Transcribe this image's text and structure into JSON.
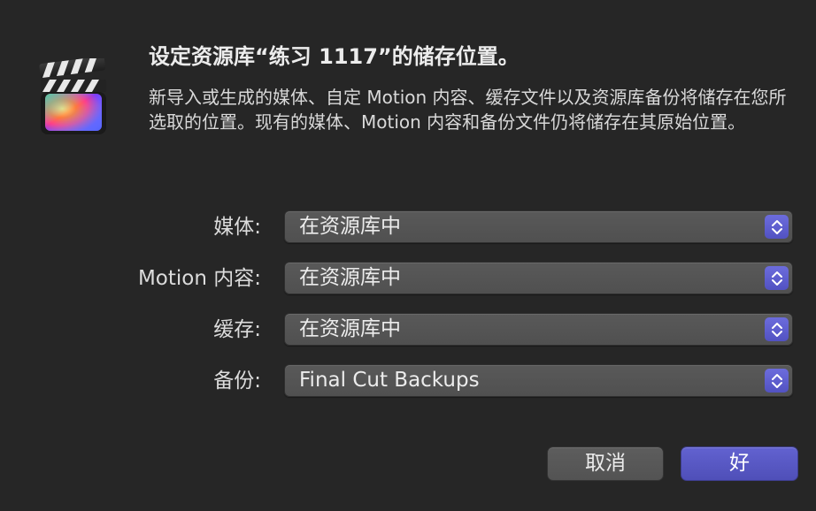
{
  "dialog": {
    "title": "设定资源库“练习 1117”的储存位置。",
    "description": "新导入或生成的媒体、自定 Motion 内容、缓存文件以及资源库备份将储存在您所选取的位置。现有的媒体、Motion 内容和备份文件仍将储存在其原始位置。",
    "app_icon": "final-cut-pro-clapperboard-icon"
  },
  "settings": [
    {
      "label": "媒体:",
      "value": "在资源库中"
    },
    {
      "label": "Motion 内容:",
      "value": "在资源库中"
    },
    {
      "label": "缓存:",
      "value": "在资源库中"
    },
    {
      "label": "备份:",
      "value": "Final Cut Backups"
    }
  ],
  "buttons": {
    "cancel": "取消",
    "ok": "好"
  },
  "colors": {
    "background": "#262626",
    "accent": "#5a5ad0"
  }
}
